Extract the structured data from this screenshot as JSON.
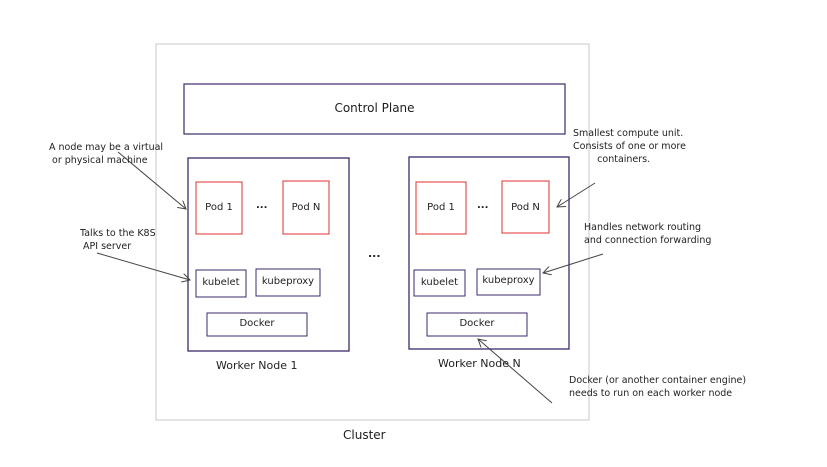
{
  "diagram": {
    "cluster_label": "Cluster",
    "control_plane_label": "Control Plane",
    "between_nodes_ellipsis": "...",
    "nodes": [
      {
        "title": "Worker Node 1",
        "pod_first": "Pod 1",
        "pod_ellipsis": "...",
        "pod_last": "Pod N",
        "kubelet": "kubelet",
        "kubeproxy": "kubeproxy",
        "docker": "Docker"
      },
      {
        "title": "Worker Node N",
        "pod_first": "Pod 1",
        "pod_ellipsis": "...",
        "pod_last": "Pod N",
        "kubelet": "kubelet",
        "kubeproxy": "kubeproxy",
        "docker": "Docker"
      }
    ],
    "annotations": {
      "node_machine": "A node may be a virtual\n or physical machine",
      "kubelet_api": "Talks to the K8S\n API server",
      "pod_unit": "Smallest compute unit.\nConsists of one or more\n        containers.",
      "kubeproxy_routing": "Handles network routing\nand connection forwarding",
      "docker_engine": "Docker (or another container engine)\nneeds to run on each worker node"
    },
    "colors": {
      "node_border": "#3d2a6b",
      "pod_border": "#e03131",
      "cluster_border": "#c8c8c8",
      "text": "#1e1e1e"
    }
  }
}
